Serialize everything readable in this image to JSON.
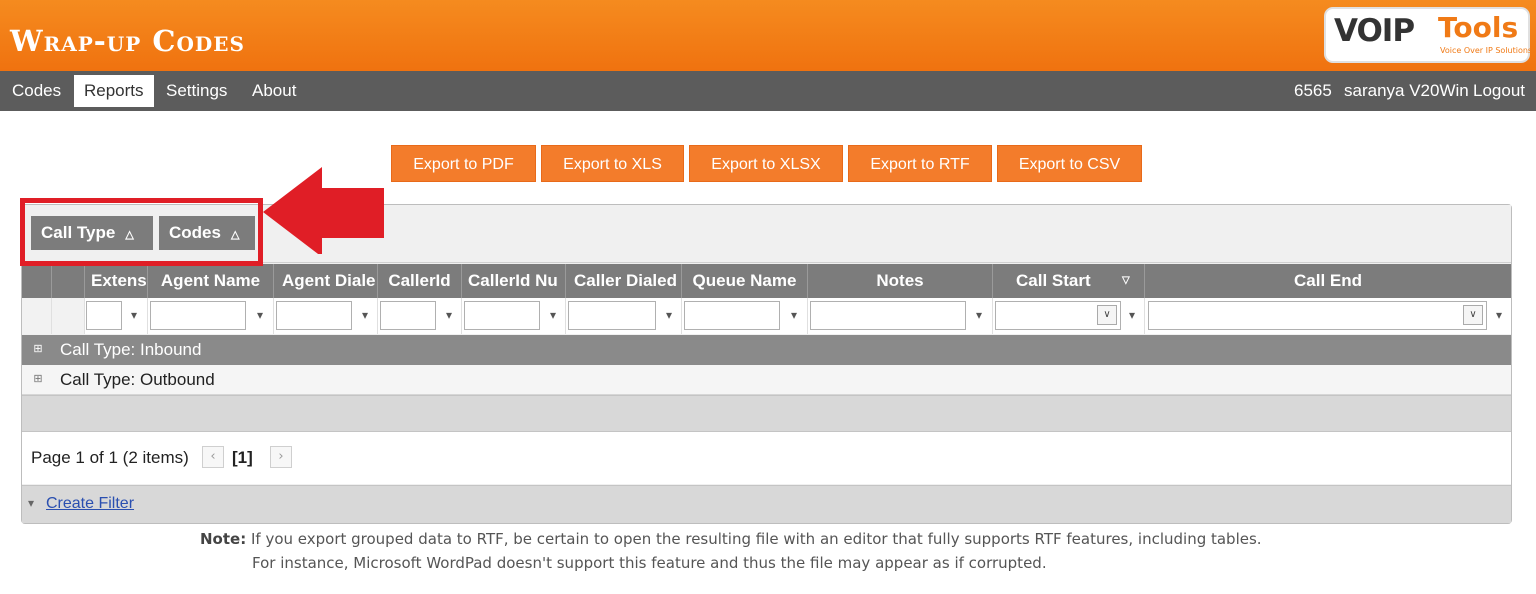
{
  "app": {
    "title": "Wrap-up Codes",
    "logo": {
      "brand_left": "VOIP",
      "brand_right": "Tools",
      "tagline": "Voice Over IP Solutions"
    }
  },
  "nav": {
    "items": [
      {
        "label": "Codes"
      },
      {
        "label": "Reports",
        "active": true
      },
      {
        "label": "Settings"
      },
      {
        "label": "About"
      }
    ],
    "user": {
      "extension": "6565",
      "name": "saranya V20Win",
      "logout": "Logout"
    }
  },
  "export": {
    "buttons": [
      "Export to PDF",
      "Export to XLS",
      "Export to XLSX",
      "Export to RTF",
      "Export to CSV"
    ]
  },
  "grid": {
    "group_by": [
      {
        "label": "Call Type",
        "sort_icon": "sort-asc-icon"
      },
      {
        "label": "Codes",
        "sort_icon": "sort-asc-icon"
      }
    ],
    "columns": [
      {
        "label": "Extens"
      },
      {
        "label": "Agent Name"
      },
      {
        "label": "Agent Diale"
      },
      {
        "label": "CallerId"
      },
      {
        "label": "CallerId Nu"
      },
      {
        "label": "Caller Dialed"
      },
      {
        "label": "Queue Name"
      },
      {
        "label": "Notes"
      },
      {
        "label": "Call Start",
        "sorted": "desc"
      },
      {
        "label": "Call End"
      }
    ],
    "groups": [
      {
        "label": "Call Type: Inbound",
        "expand_icon": "expand-icon"
      },
      {
        "label": "Call Type: Outbound",
        "expand_icon": "expand-icon"
      }
    ],
    "pager": {
      "summary": "Page 1 of 1 (2 items)",
      "current": "[1]",
      "prev_icon": "chevron-left-icon",
      "next_icon": "chevron-right-icon"
    },
    "filter_link": "Create Filter"
  },
  "note": {
    "label": "Note:",
    "line1": "If you export grouped data to RTF, be certain to open the resulting file with an editor that fully supports RTF features, including tables.",
    "line2": "For instance, Microsoft WordPad doesn't support this feature and thus the file may appear as if corrupted."
  },
  "colors": {
    "header": "#f37c1a",
    "nav": "#5c5c5c",
    "export": "#f37c2b",
    "highlight": "#e01e26",
    "grid_header": "#7c7c7c"
  }
}
